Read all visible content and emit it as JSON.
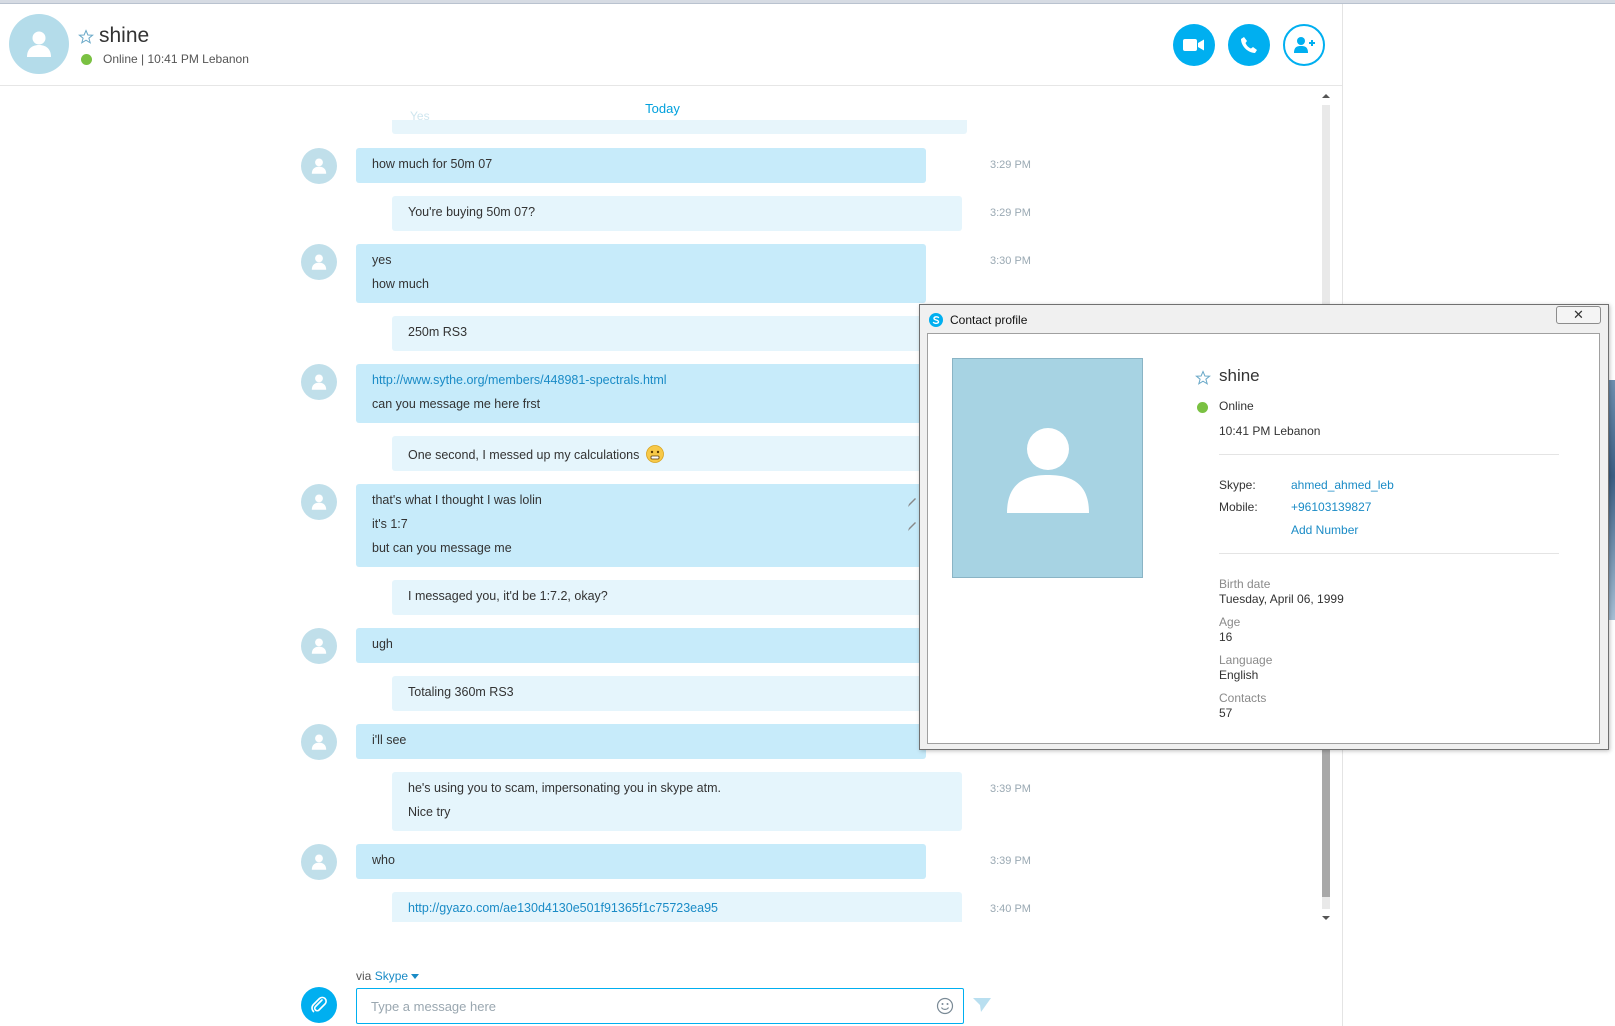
{
  "header": {
    "name": "shine",
    "status": "Online  |  10:41 PM Lebanon"
  },
  "conversation": {
    "date_divider": "Today",
    "ghost_text": "Yes",
    "messages": [
      {
        "from": "them",
        "lines": [
          "how much for 50m 07"
        ],
        "time": "3:29 PM"
      },
      {
        "from": "me",
        "lines": [
          "You're buying 50m 07?"
        ],
        "time": "3:29 PM"
      },
      {
        "from": "them",
        "lines": [
          "yes",
          "how much"
        ],
        "time": "3:30 PM"
      },
      {
        "from": "me",
        "lines": [
          "250m RS3"
        ],
        "time": ""
      },
      {
        "from": "them",
        "lines": [
          "http://www.sythe.org/members/448981-spectrals.html",
          "can you message me here frst"
        ],
        "time": ""
      },
      {
        "from": "me",
        "lines": [
          "One second, I messed up my calculations"
        ],
        "time": ""
      },
      {
        "from": "them",
        "lines": [
          "that's what I thought I was lolin",
          "it's 1:7",
          "but can you message me"
        ],
        "time": ""
      },
      {
        "from": "me",
        "lines": [
          "I messaged you, it'd be 1:7.2, okay?"
        ],
        "time": ""
      },
      {
        "from": "them",
        "lines": [
          "ugh"
        ],
        "time": ""
      },
      {
        "from": "me",
        "lines": [
          "Totaling 360m RS3"
        ],
        "time": ""
      },
      {
        "from": "them",
        "lines": [
          "i'll see"
        ],
        "time": ""
      },
      {
        "from": "me",
        "lines": [
          "he's using you to scam, impersonating you in skype atm.",
          "Nice try"
        ],
        "time": "3:39 PM"
      },
      {
        "from": "them",
        "lines": [
          "who"
        ],
        "time": "3:39 PM"
      },
      {
        "from": "me",
        "lines": [
          "http://gyazo.com/ae130d4130e501f91365f1c75723ea95"
        ],
        "time": "3:40 PM"
      }
    ]
  },
  "composer": {
    "via_label": "via",
    "via_service": "Skype",
    "placeholder": "Type a message here"
  },
  "profile": {
    "window_title": "Contact profile",
    "close_glyph": "✕",
    "name": "shine",
    "status": "Online",
    "local_time": "10:41 PM Lebanon",
    "skype_label": "Skype:",
    "skype_value": "ahmed_ahmed_leb",
    "mobile_label": "Mobile:",
    "mobile_value": "+96103139827",
    "add_number": "Add Number",
    "birth_label": "Birth date",
    "birth_value": "Tuesday, April 06, 1999",
    "age_label": "Age",
    "age_value": "16",
    "language_label": "Language",
    "language_value": "English",
    "contacts_label": "Contacts",
    "contacts_value": "57"
  },
  "colors": {
    "accent": "#00aff0",
    "bubble_them": "#c7ebfa",
    "bubble_me": "#e5f5fc",
    "online": "#7ac142",
    "link": "#1a8bc6"
  }
}
